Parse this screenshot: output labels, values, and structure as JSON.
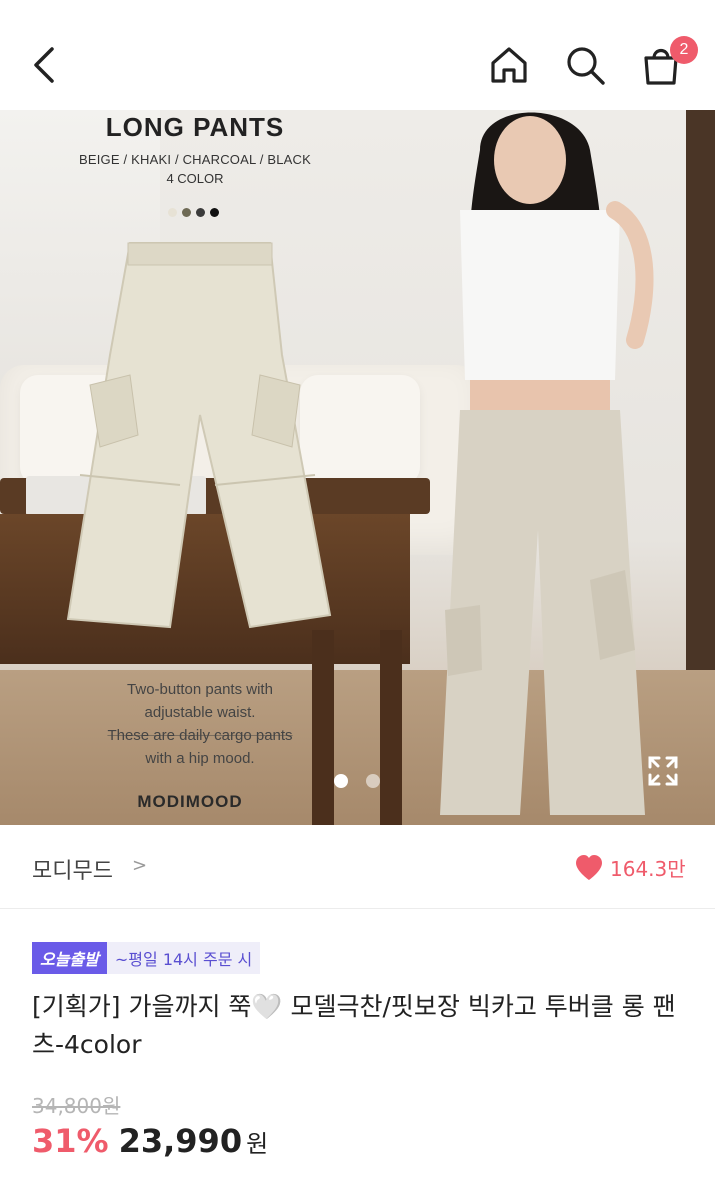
{
  "header": {
    "cart_count": "2"
  },
  "hero": {
    "title": "LONG PANTS",
    "colors": "BEIGE / KHAKI / CHARCOAL / BLACK",
    "color_count": "4 COLOR",
    "swatches": [
      "#e7e2d5",
      "#6e6a55",
      "#3b3b3b",
      "#111111"
    ],
    "desc_lines": [
      "Two-button pants with",
      "adjustable waist.",
      "These are daily cargo pants",
      "with a hip mood."
    ],
    "brand": "MODIMOOD",
    "slide_index": 1,
    "slide_total": 2
  },
  "brand_row": {
    "name": "모디무드",
    "chevron": ">",
    "likes": "164.3만"
  },
  "product": {
    "badge_today": "오늘출발",
    "badge_note": "~평일 14시 주문 시",
    "title": "[기획가] 가을까지 쭉🤍 모델극찬/핏보장 빅카고 투버클 롱 팬츠-4color",
    "original_price": "34,800원",
    "discount": "31%",
    "sale_price": "23,990",
    "currency": "원"
  },
  "colors": {
    "accent": "#ef5b6b",
    "badge": "#6a5be8"
  }
}
